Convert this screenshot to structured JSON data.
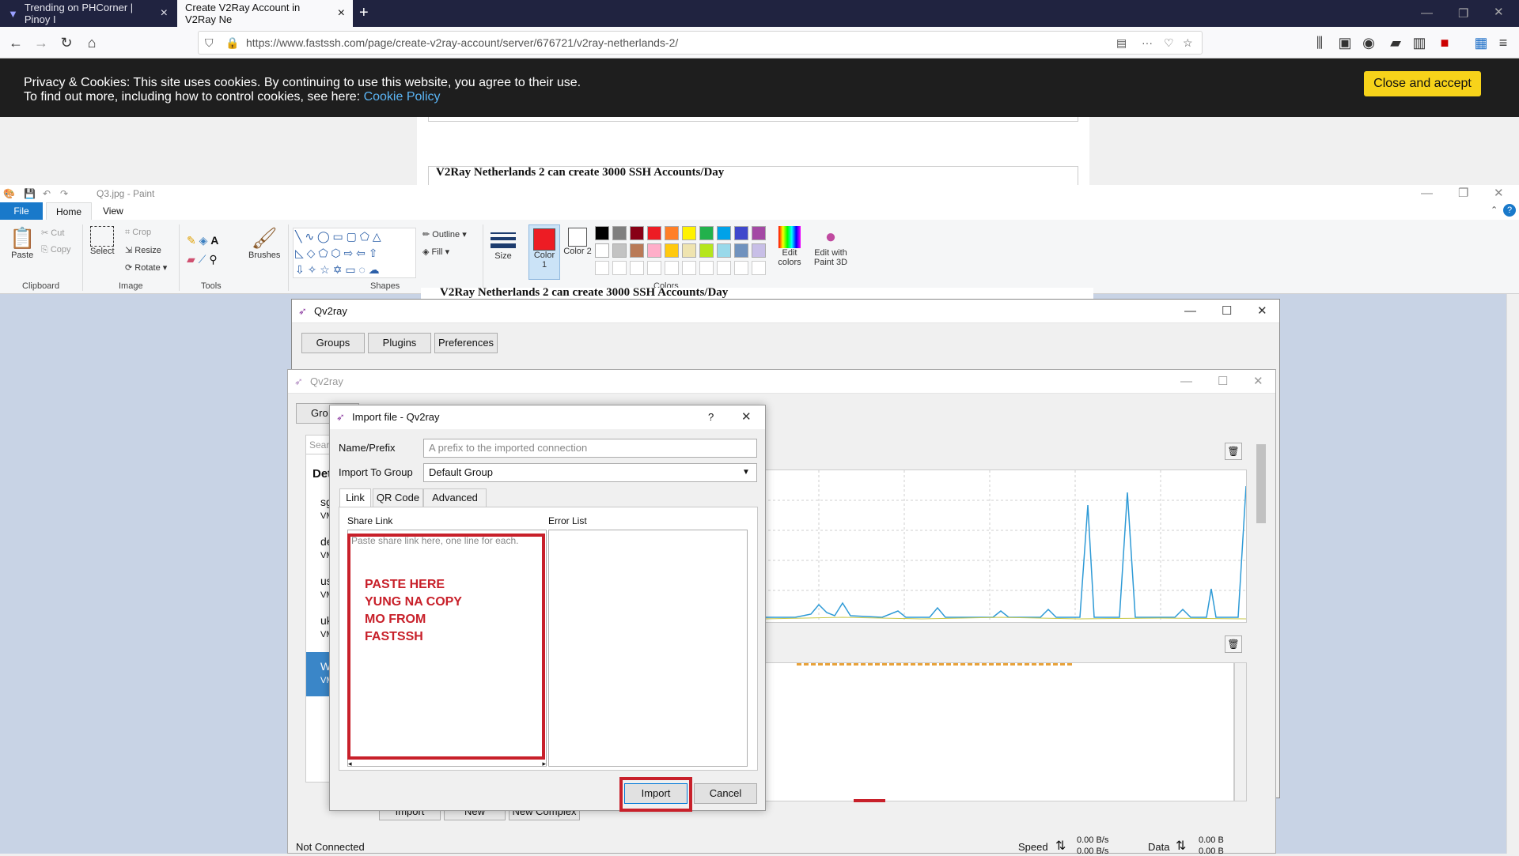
{
  "browser": {
    "tabs": [
      {
        "label": "Trending on PHCorner | Pinoy I"
      },
      {
        "label": "Create V2Ray Account in V2Ray Ne"
      }
    ],
    "url": "https://www.fastssh.com/page/create-v2ray-account/server/676721/v2ray-netherlands-2/"
  },
  "cookie_banner": {
    "line1": "Privacy & Cookies: This site uses cookies. By continuing to use this website, you agree to their use.",
    "line2": "To find out more, including how to control cookies, see here:",
    "link": "Cookie Policy",
    "accept": "Close and accept"
  },
  "webpage": {
    "heading": "V2Ray Netherlands 2 can create 3000 SSH Accounts/Day"
  },
  "paint": {
    "title": "Q3.jpg - Paint",
    "menu": [
      "File",
      "Home",
      "View"
    ],
    "clipboard": {
      "paste": "Paste",
      "cut": "Cut",
      "copy": "Copy",
      "label": "Clipboard"
    },
    "image": {
      "select": "Select",
      "crop": "Crop",
      "resize": "Resize",
      "rotate": "Rotate",
      "label": "Image"
    },
    "tools": {
      "label": "Tools"
    },
    "brushes": "Brushes",
    "shapes": {
      "outline": "Outline",
      "fill": "Fill",
      "label": "Shapes"
    },
    "size": "Size",
    "color1": "Color 1",
    "color2": "Color 2",
    "colors_label": "Colors",
    "edit_colors": "Edit colors",
    "paint3d": "Edit with Paint 3D",
    "palette": [
      "#000000",
      "#7f7f7f",
      "#880015",
      "#ed1c24",
      "#ff7f27",
      "#fff200",
      "#22b14c",
      "#00a2e8",
      "#3f48cc",
      "#a349a4",
      "#ffffff",
      "#c3c3c3",
      "#b97a57",
      "#ffaec9",
      "#ffc90e",
      "#efe4b0",
      "#b5e61d",
      "#99d9ea",
      "#7092be",
      "#c8bfe7"
    ]
  },
  "qv2ray_main": {
    "title": "Qv2ray",
    "buttons": [
      "Groups",
      "Plugins",
      "Preferences"
    ]
  },
  "qv2ray_second": {
    "title": "Qv2ray",
    "status": "Not Connected",
    "speed_label": "Speed",
    "speed_up": "0.00 B/s",
    "speed_down": "0.00 B/s",
    "data_label": "Data",
    "data_up": "0.00 B",
    "data_down": "0.00 B",
    "bottom_buttons": [
      "Import",
      "New",
      "New Complex"
    ],
    "partial_tabs": [
      "Gro"
    ],
    "search_partial": "Searc",
    "list_header": "Det",
    "list_items": [
      "sg",
      "de",
      "us",
      "uk",
      "W"
    ],
    "list_sub": "VM"
  },
  "import_dialog": {
    "title": "Import file - Qv2ray",
    "help": "?",
    "name_label": "Name/Prefix",
    "name_placeholder": "A prefix to the imported connection",
    "group_label": "Import To Group",
    "group_value": "Default Group",
    "tabs": [
      "Link",
      "QR Code",
      "Advanced"
    ],
    "share_link_label": "Share Link",
    "error_list_label": "Error List",
    "share_placeholder": "Paste share link here, one line for each.",
    "annotation": [
      "PASTE HERE",
      "YUNG NA COPY",
      "MO FROM",
      "FASTSSH"
    ],
    "import_button": "Import",
    "cancel_button": "Cancel"
  },
  "colors": {
    "accent_red": "#c8202a",
    "cookie_button": "#f7d31a",
    "chart_line": "#2e9ad6"
  }
}
